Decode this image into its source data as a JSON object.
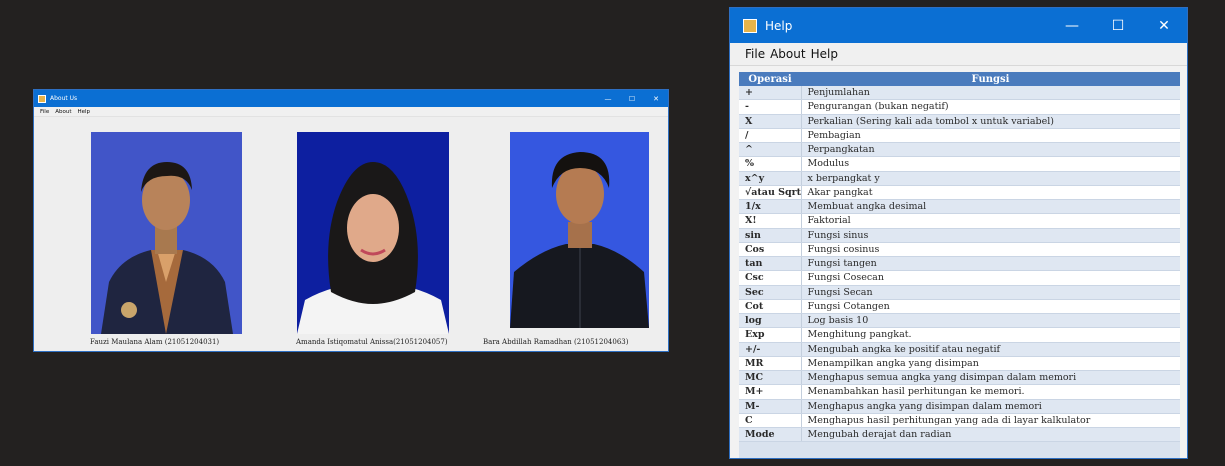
{
  "about_window": {
    "title": "About Us",
    "controls": {
      "minimize": "—",
      "maximize": "☐",
      "close": "✕"
    },
    "menu": [
      "File",
      "About",
      "Help"
    ],
    "members": [
      {
        "caption": "Fauzi Maulana Alam (21051204031)"
      },
      {
        "caption": "Amanda Istiqomatul Anissa(21051204057)"
      },
      {
        "caption": "Bara Abdillah Ramadhan (21051204063)"
      }
    ]
  },
  "help_window": {
    "title": "Help",
    "controls": {
      "minimize": "—",
      "maximize": "☐",
      "close": "✕"
    },
    "menu": [
      "File",
      "About",
      "Help"
    ],
    "table": {
      "headers": [
        "Operasi",
        "Fungsi"
      ],
      "rows": [
        [
          "+",
          "Penjumlahan"
        ],
        [
          "-",
          "Pengurangan (bukan negatif)"
        ],
        [
          "X",
          "Perkalian (Sering kali ada tombol x untuk variabel)"
        ],
        [
          "/",
          "Pembagian"
        ],
        [
          "^",
          "Perpangkatan"
        ],
        [
          "%",
          "Modulus"
        ],
        [
          "x^y",
          "x berpangkat y"
        ],
        [
          "√atau Sqrt",
          "Akar pangkat"
        ],
        [
          "1/x",
          "Membuat angka desimal"
        ],
        [
          "X!",
          "Faktorial"
        ],
        [
          "sin",
          "Fungsi sinus"
        ],
        [
          "Cos",
          "Fungsi cosinus"
        ],
        [
          "tan",
          "Fungsi tangen"
        ],
        [
          "Csc",
          "Fungsi Cosecan"
        ],
        [
          "Sec",
          "Fungsi Secan"
        ],
        [
          "Cot",
          "Fungsi Cotangen"
        ],
        [
          "log",
          "Log basis 10"
        ],
        [
          "Exp",
          "Menghitung pangkat."
        ],
        [
          "+/-",
          "Mengubah angka ke positif atau negatif"
        ],
        [
          "MR",
          "Menampilkan angka yang disimpan"
        ],
        [
          "MC",
          "Menghapus semua angka yang disimpan dalam memori"
        ],
        [
          "M+",
          "Menambahkan hasil perhitungan ke memori."
        ],
        [
          "M-",
          "Menghapus angka yang disimpan dalam memori"
        ],
        [
          "C",
          "Menghapus hasil perhitungan yang ada di layar kalkulator"
        ],
        [
          "Mode",
          "Mengubah derajat dan radian"
        ]
      ]
    }
  },
  "colors": {
    "titlebar": "#0b6fd3",
    "table_header": "#4a7bbd",
    "photo_bg_blue": "#3c57c9"
  }
}
